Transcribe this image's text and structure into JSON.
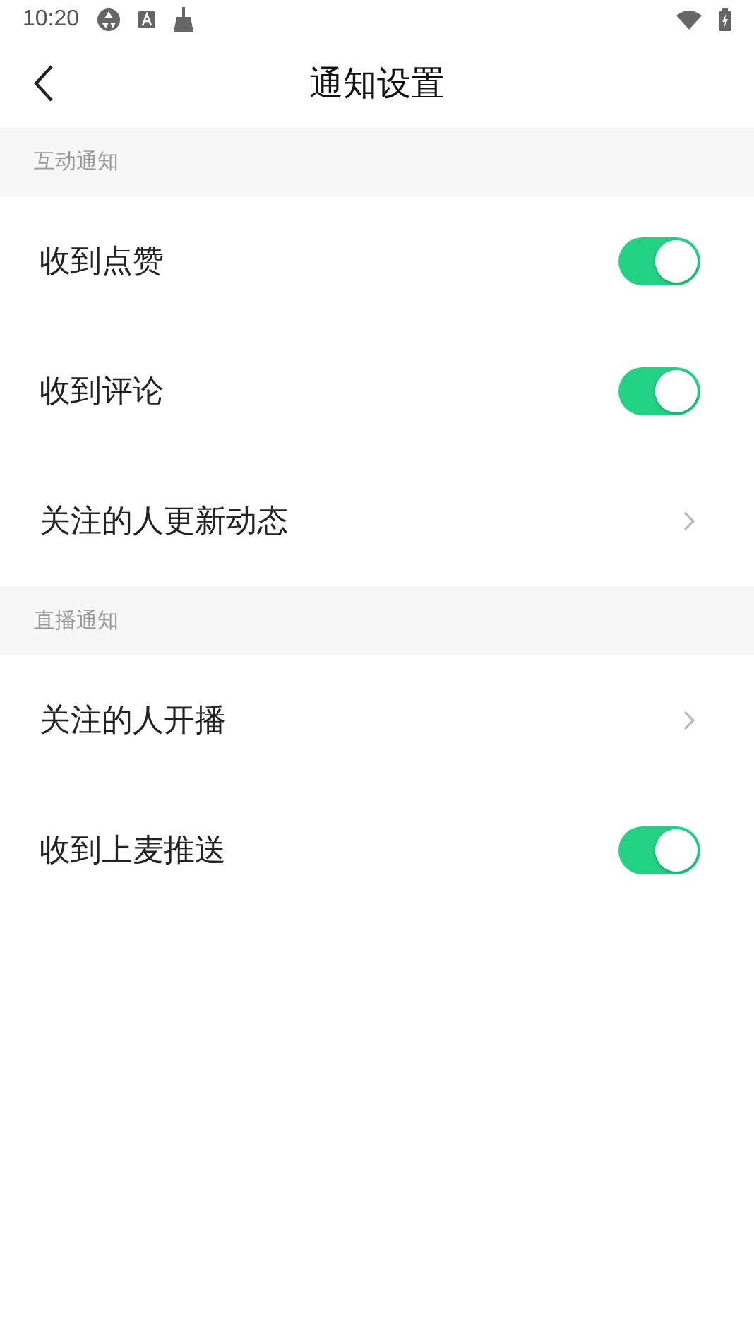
{
  "status_bar": {
    "time": "10:20"
  },
  "header": {
    "title": "通知设置"
  },
  "sections": [
    {
      "title": "互动通知",
      "items": [
        {
          "label": "收到点赞",
          "kind": "toggle",
          "on": true
        },
        {
          "label": "收到评论",
          "kind": "toggle",
          "on": true
        },
        {
          "label": "关注的人更新动态",
          "kind": "link"
        }
      ]
    },
    {
      "title": "直播通知",
      "items": [
        {
          "label": "关注的人开播",
          "kind": "link"
        },
        {
          "label": "收到上麦推送",
          "kind": "toggle",
          "on": true
        }
      ]
    }
  ]
}
